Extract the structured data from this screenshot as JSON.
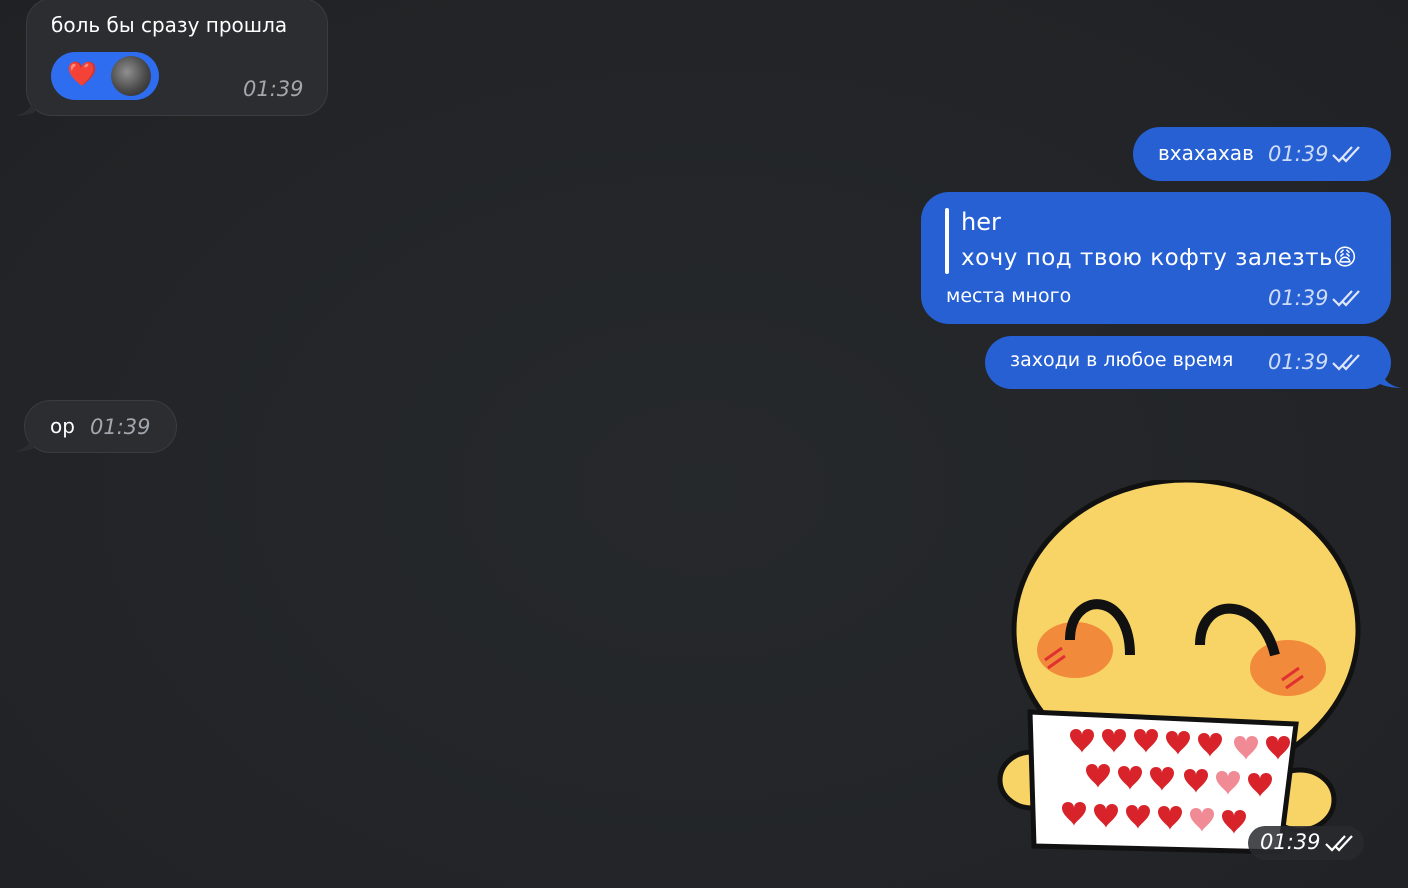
{
  "messages": {
    "m1": {
      "text": "боль бы сразу прошла",
      "time": "01:39",
      "reaction": "❤️"
    },
    "m2": {
      "text": "вхахахав",
      "time": "01:39"
    },
    "m3": {
      "quote_author": "her",
      "quote_text": "хочу под твою кофту залезть😩",
      "text": "места много",
      "time": "01:39"
    },
    "m4": {
      "text": "заходи в любое время",
      "time": "01:39"
    },
    "m5": {
      "text": "ор",
      "time": "01:39"
    },
    "sticker": {
      "time": "01:39",
      "icon": "smiley-holding-hearts-sign-sticker"
    }
  },
  "colors": {
    "background": "#232528",
    "incoming_bubble": "#2b2d30",
    "outgoing_bubble": "#2660d3",
    "reaction_pill": "#2f6df0"
  }
}
